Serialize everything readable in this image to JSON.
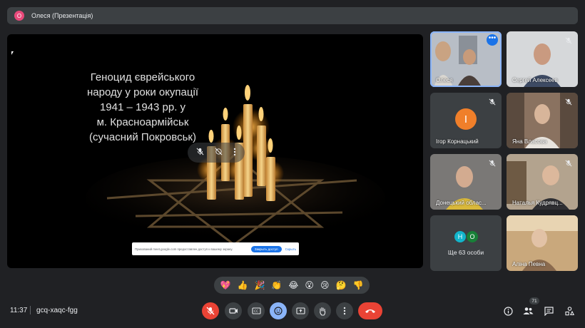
{
  "presenter_bar": {
    "avatar_letter": "О",
    "title": "Олеся (Презентація)"
  },
  "slide": {
    "title": "Геноцид єврейського\nнароду у роки окупації\n1941 – 1943 рр. у\nм. Красноармійськ\n(сучасний Покровськ)"
  },
  "share_notice": {
    "text": "Прихований meet.google.com предоставлен доступ к вашему экрану.",
    "stop_label": "Закрыть доступ",
    "hide_label": "Скрыть"
  },
  "participants": [
    {
      "name": "Олеся"
    },
    {
      "name": "Сергей Алексеев"
    },
    {
      "name": "Ігор Корнацький",
      "initial": "І"
    },
    {
      "name": "Яна Власова"
    },
    {
      "name": "Донецький облас..."
    },
    {
      "name": "Наталья Кудрявц..."
    },
    {
      "name": "Аліна Певна"
    }
  ],
  "more_people": {
    "label": "Ще 63 особи",
    "a": "Н",
    "b": "О"
  },
  "reactions": [
    "💖",
    "👍",
    "🎉",
    "👏",
    "😂",
    "😮",
    "😢",
    "🤔",
    "👎"
  ],
  "bottom": {
    "time": "11:37",
    "meeting_code": "gcq-xaqc-fgg",
    "people_count": "71"
  },
  "colors": {
    "background": "#202124",
    "surface": "#3c4043",
    "end_call": "#ea4335",
    "accent": "#1a73e8"
  }
}
